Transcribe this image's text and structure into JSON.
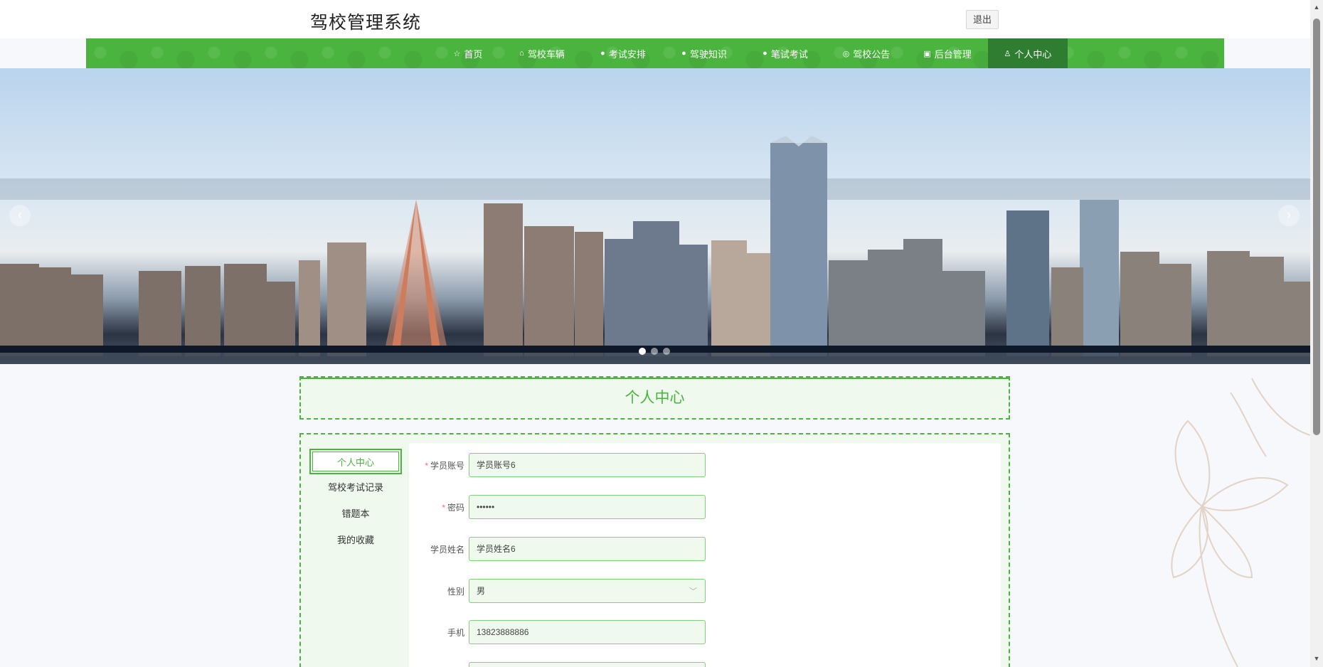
{
  "header": {
    "title": "驾校管理系统",
    "logout_label": "退出"
  },
  "nav": {
    "items": [
      {
        "label": "首页",
        "icon": "☆"
      },
      {
        "label": "驾校车辆",
        "icon": "⌂"
      },
      {
        "label": "考试安排",
        "icon": "●"
      },
      {
        "label": "驾驶知识",
        "icon": "●"
      },
      {
        "label": "笔试考试",
        "icon": "●"
      },
      {
        "label": "驾校公告",
        "icon": "◎"
      },
      {
        "label": "后台管理",
        "icon": "▣"
      },
      {
        "label": "个人中心",
        "icon": "♙"
      }
    ],
    "active_index": 7
  },
  "banner": {
    "prev_glyph": "‹",
    "next_glyph": "›",
    "slide_count": 3,
    "active_slide": 0
  },
  "page": {
    "title": "个人中心"
  },
  "side_menu": {
    "items": [
      "个人中心",
      "驾校考试记录",
      "错题本",
      "我的收藏"
    ],
    "active_index": 0
  },
  "form": {
    "account": {
      "label": "学员账号",
      "value": "学员账号6",
      "required": "*"
    },
    "password": {
      "label": "密码",
      "value": "••••••",
      "required": "*"
    },
    "name": {
      "label": "学员姓名",
      "value": "学员姓名6"
    },
    "gender": {
      "label": "性别",
      "value": "男"
    },
    "phone": {
      "label": "手机",
      "value": "13823888886"
    }
  },
  "colors": {
    "accent": "#4bb43f",
    "nav_active": "#2f7d31",
    "field_bg": "#eff9ee",
    "required": "#f56c6c"
  }
}
